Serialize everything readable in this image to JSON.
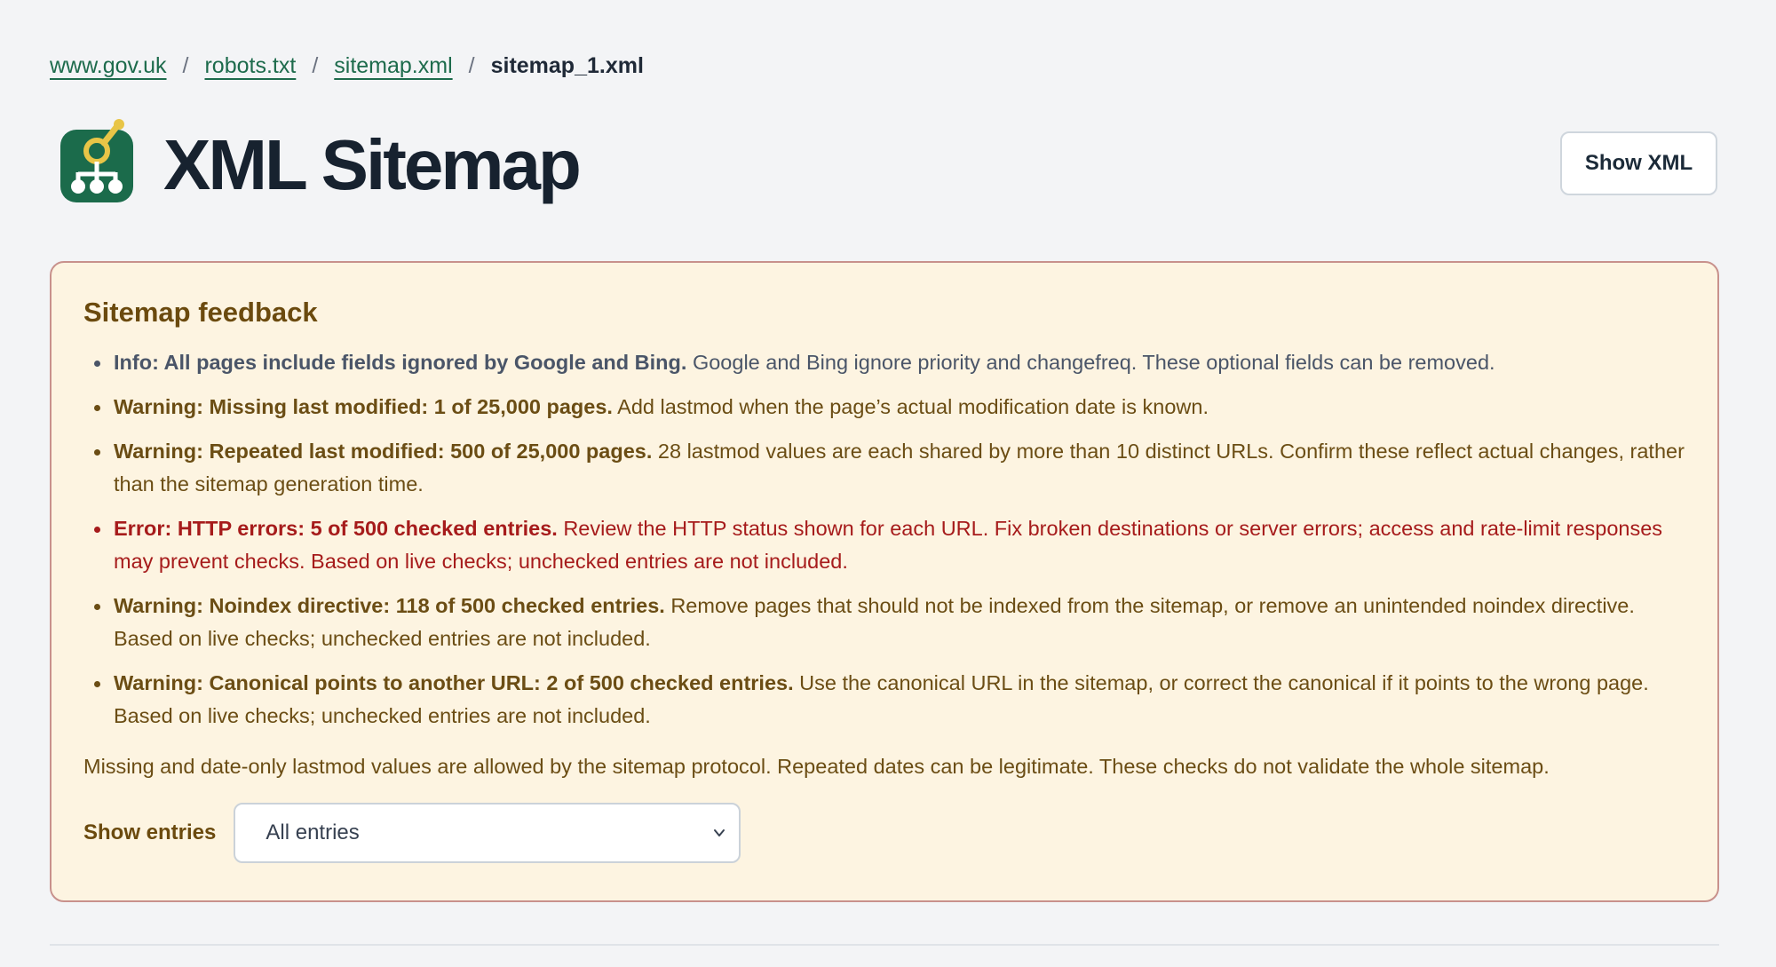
{
  "breadcrumb": {
    "items": [
      {
        "label": "www.gov.uk"
      },
      {
        "label": "robots.txt"
      },
      {
        "label": "sitemap.xml"
      }
    ],
    "separator": "/",
    "current": "sitemap_1.xml"
  },
  "header": {
    "title": "XML Sitemap",
    "logo_icon": "sitemap-search-icon",
    "show_xml_label": "Show XML"
  },
  "feedback": {
    "title": "Sitemap feedback",
    "items": [
      {
        "level": "info",
        "strong": "Info: All pages include fields ignored by Google and Bing.",
        "text": " Google and Bing ignore priority and changefreq. These optional fields can be removed."
      },
      {
        "level": "warning",
        "strong": "Warning: Missing last modified: 1 of 25,000 pages.",
        "text": " Add lastmod when the page’s actual modification date is known."
      },
      {
        "level": "warning",
        "strong": "Warning: Repeated last modified: 500 of 25,000 pages.",
        "text": " 28 lastmod values are each shared by more than 10 distinct URLs. Confirm these reflect actual changes, rather than the sitemap generation time."
      },
      {
        "level": "error",
        "strong": "Error: HTTP errors: 5 of 500 checked entries.",
        "text": " Review the HTTP status shown for each URL. Fix broken destinations or server errors; access and rate-limit responses may prevent checks. Based on live checks; unchecked entries are not included."
      },
      {
        "level": "warning",
        "strong": "Warning: Noindex directive: 118 of 500 checked entries.",
        "text": " Remove pages that should not be indexed from the sitemap, or remove an unintended noindex directive. Based on live checks; unchecked entries are not included."
      },
      {
        "level": "warning",
        "strong": "Warning: Canonical points to another URL: 2 of 500 checked entries.",
        "text": " Use the canonical URL in the sitemap, or correct the canonical if it points to the wrong page. Based on live checks; unchecked entries are not included."
      }
    ],
    "note": "Missing and date-only lastmod values are allowed by the sitemap protocol. Repeated dates can be legitimate. These checks do not validate the whole sitemap.",
    "filter": {
      "label": "Show entries",
      "selected": "All entries"
    }
  },
  "colors": {
    "link": "#1d6b4c",
    "info": "#4a5568",
    "warning": "#6b4d14",
    "error": "#a61b1b",
    "panel_background": "#fdf4e1",
    "panel_border": "#c8918c",
    "logo_green": "#1b6b4b",
    "logo_yellow": "#e8c547"
  }
}
